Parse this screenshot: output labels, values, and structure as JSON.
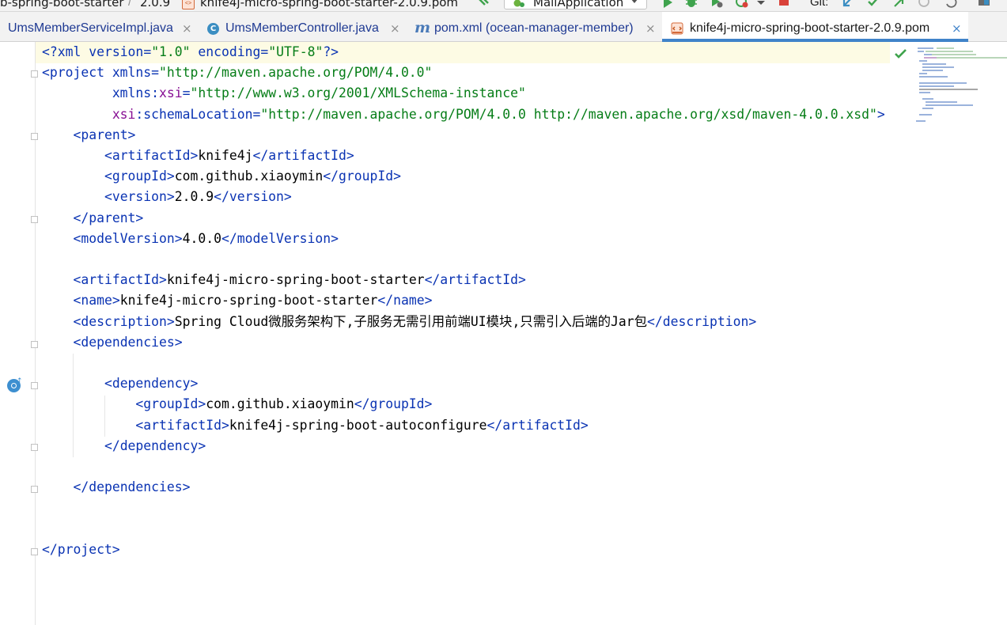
{
  "navbar": {
    "breadcrumb": [
      "b-spring-boot-starter",
      "2.0.9",
      "knife4j-micro-spring-boot-starter-2.0.9.pom"
    ],
    "separator": "/",
    "pom_icon_text": "<>",
    "run_config": "MallApplication",
    "git_label": "Git:",
    "icons": [
      "build-hammer-icon",
      "run-icon",
      "debug-icon",
      "coverage-icon",
      "profile-icon",
      "stop-icon",
      "git-update-icon",
      "git-commit-icon",
      "git-push-icon",
      "history-icon",
      "rollback-icon",
      "layout-icon"
    ],
    "colors": {
      "run": "#3fa34d",
      "stop": "#d9423a",
      "git": "#3b8ec2"
    }
  },
  "tabs": [
    {
      "label": "UmsMemberServiceImpl.java",
      "icon": "none",
      "active": false
    },
    {
      "label": "UmsMemberController.java",
      "icon": "class-icon",
      "icon_text": "C",
      "active": false
    },
    {
      "label": "pom.xml (ocean-manager-member)",
      "icon": "maven-icon",
      "icon_text": "m",
      "active": false
    },
    {
      "label": "knife4j-micro-spring-boot-starter-2.0.9.pom",
      "icon": "pom-file-icon",
      "icon_text": "<>",
      "active": true
    }
  ],
  "tab_close": "×",
  "editor": {
    "lines": [
      [
        [
          "tag",
          "<?"
        ],
        [
          "attr",
          "xml version"
        ],
        [
          "tag",
          "="
        ],
        [
          "val",
          "\"1.0\""
        ],
        [
          "tag",
          " "
        ],
        [
          "attr",
          "encoding"
        ],
        [
          "tag",
          "="
        ],
        [
          "val",
          "\"UTF-8\""
        ],
        [
          "tag",
          "?>"
        ]
      ],
      [
        [
          "tag",
          "<project "
        ],
        [
          "attr",
          "xmlns"
        ],
        [
          "tag",
          "="
        ],
        [
          "val",
          "\"http://maven.apache.org/POM/4.0.0\""
        ]
      ],
      [
        [
          "txt",
          "         "
        ],
        [
          "attr",
          "xmlns"
        ],
        [
          "tag",
          ":"
        ],
        [
          "ns",
          "xsi"
        ],
        [
          "tag",
          "="
        ],
        [
          "val",
          "\"http://www.w3.org/2001/XMLSchema-instance\""
        ]
      ],
      [
        [
          "txt",
          "         "
        ],
        [
          "ns",
          "xsi"
        ],
        [
          "tag",
          ":"
        ],
        [
          "attr",
          "schemaLocation"
        ],
        [
          "tag",
          "="
        ],
        [
          "val",
          "\"http://maven.apache.org/POM/4.0.0 http://maven.apache.org/xsd/maven-4.0.0.xsd\""
        ],
        [
          "tag",
          ">"
        ]
      ],
      [
        [
          "txt",
          "    "
        ],
        [
          "tag",
          "<parent>"
        ]
      ],
      [
        [
          "txt",
          "        "
        ],
        [
          "tag",
          "<artifactId>"
        ],
        [
          "txt",
          "knife4j"
        ],
        [
          "tag",
          "</artifactId>"
        ]
      ],
      [
        [
          "txt",
          "        "
        ],
        [
          "tag",
          "<groupId>"
        ],
        [
          "txt",
          "com.github.xiaoymin"
        ],
        [
          "tag",
          "</groupId>"
        ]
      ],
      [
        [
          "txt",
          "        "
        ],
        [
          "tag",
          "<version>"
        ],
        [
          "txt",
          "2.0.9"
        ],
        [
          "tag",
          "</version>"
        ]
      ],
      [
        [
          "txt",
          "    "
        ],
        [
          "tag",
          "</parent>"
        ]
      ],
      [
        [
          "txt",
          "    "
        ],
        [
          "tag",
          "<modelVersion>"
        ],
        [
          "txt",
          "4.0.0"
        ],
        [
          "tag",
          "</modelVersion>"
        ]
      ],
      [],
      [
        [
          "txt",
          "    "
        ],
        [
          "tag",
          "<artifactId>"
        ],
        [
          "txt",
          "knife4j-micro-spring-boot-starter"
        ],
        [
          "tag",
          "</artifactId>"
        ]
      ],
      [
        [
          "txt",
          "    "
        ],
        [
          "tag",
          "<name>"
        ],
        [
          "txt",
          "knife4j-micro-spring-boot-starter"
        ],
        [
          "tag",
          "</name>"
        ]
      ],
      [
        [
          "txt",
          "    "
        ],
        [
          "tag",
          "<description>"
        ],
        [
          "txt",
          "Spring Cloud微服务架构下,子服务无需引用前端UI模块,只需引入后端的Jar包"
        ],
        [
          "tag",
          "</description>"
        ]
      ],
      [
        [
          "txt",
          "    "
        ],
        [
          "tag",
          "<dependencies>"
        ]
      ],
      [],
      [
        [
          "txt",
          "        "
        ],
        [
          "tag",
          "<dependency>"
        ]
      ],
      [
        [
          "txt",
          "            "
        ],
        [
          "tag",
          "<groupId>"
        ],
        [
          "txt",
          "com.github.xiaoymin"
        ],
        [
          "tag",
          "</groupId>"
        ]
      ],
      [
        [
          "txt",
          "            "
        ],
        [
          "tag",
          "<artifactId>"
        ],
        [
          "txt",
          "knife4j-spring-boot-autoconfigure"
        ],
        [
          "tag",
          "</artifactId>"
        ]
      ],
      [
        [
          "txt",
          "        "
        ],
        [
          "tag",
          "</dependency>"
        ]
      ],
      [],
      [
        [
          "txt",
          "    "
        ],
        [
          "tag",
          "</dependencies>"
        ]
      ],
      [],
      [],
      [
        [
          "tag",
          "</project>"
        ]
      ]
    ],
    "fold_lines": [
      2,
      5,
      9,
      15,
      17,
      20,
      22,
      25
    ],
    "implementation_marker_line": 17,
    "inspection_status": "ok-check-icon",
    "colors": {
      "tag": "#0a33b3",
      "namespace": "#871094",
      "value": "#067d17",
      "text": "#000000",
      "current_line": "#fdfbe4"
    }
  }
}
